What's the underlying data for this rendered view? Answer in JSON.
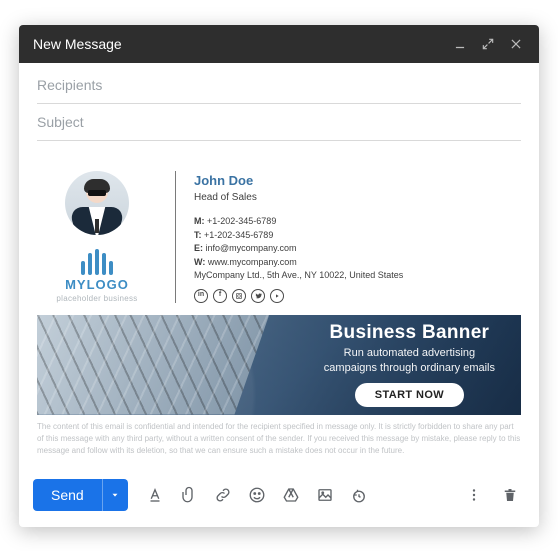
{
  "header": {
    "title": "New Message"
  },
  "fields": {
    "recipients_placeholder": "Recipients",
    "subject_placeholder": "Subject"
  },
  "signature": {
    "logo": {
      "brand": "MYLOGO",
      "tagline": "placeholder business"
    },
    "name": "John Doe",
    "title": "Head of Sales",
    "mobile_label": "M:",
    "mobile_value": "+1-202-345-6789",
    "tel_label": "T:",
    "tel_value": "+1-202-345-6789",
    "email_label": "E:",
    "email_value": "info@mycompany.com",
    "web_label": "W:",
    "web_value": "www.mycompany.com",
    "address": "MyCompany Ltd., 5th Ave., NY 10022, United States",
    "socials": [
      "in",
      "f",
      "",
      "",
      ""
    ]
  },
  "banner": {
    "title": "Business Banner",
    "subtitle": "Run automated advertising\ncampaigns through ordinary emails",
    "cta": "START NOW"
  },
  "disclaimer": "The content of this email is confidential and intended for the recipient specified in message only. It is strictly forbidden to share any part of this message with any third party, without a written consent of the sender. If you received this message by mistake, please reply to this message and follow with its deletion, so that we can ensure such a mistake does not occur in the future.",
  "footer": {
    "send": "Send"
  }
}
